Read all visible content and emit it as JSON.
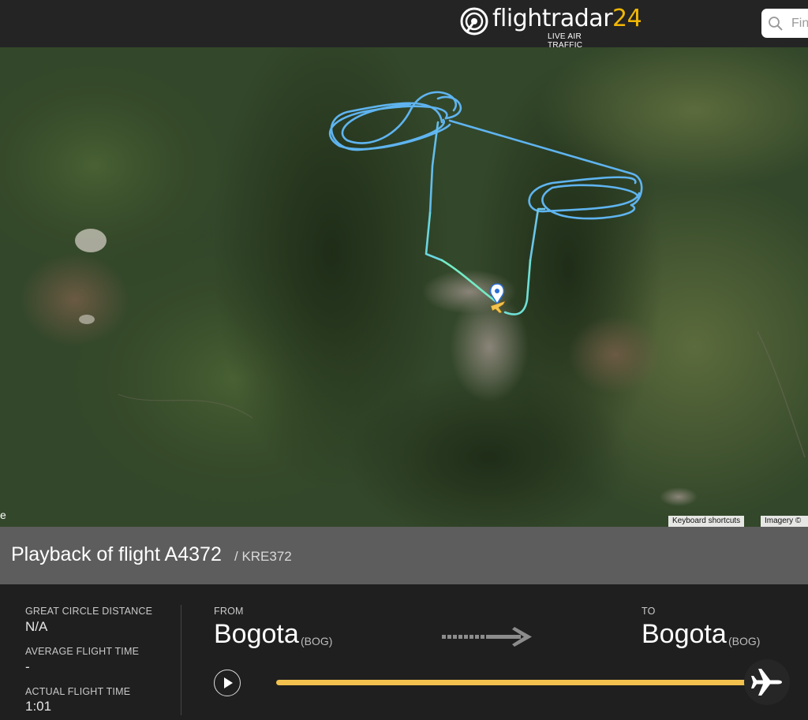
{
  "header": {
    "logo_text": "flightradar",
    "logo_number": "24",
    "tagline": "LIVE AIR TRAFFIC",
    "search_placeholder": "Fin"
  },
  "map": {
    "keyboard_shortcuts": "Keyboard shortcuts",
    "imagery_label": "Imagery ©",
    "edge_glyph": "e"
  },
  "playback": {
    "title": "Playback of flight A4372",
    "callsign": "/ KRE372"
  },
  "stats": {
    "great_circle_label": "GREAT CIRCLE DISTANCE",
    "great_circle_value": "N/A",
    "avg_label": "AVERAGE FLIGHT TIME",
    "avg_value": "-",
    "actual_label": "ACTUAL FLIGHT TIME",
    "actual_value": "1:01"
  },
  "route": {
    "from_label": "FROM",
    "from_city": "Bogota",
    "from_code": "(BOG)",
    "to_label": "TO",
    "to_city": "Bogota",
    "to_code": "(BOG)"
  },
  "player": {
    "progress": 1.0
  },
  "colors": {
    "accent": "#f2c14e",
    "track_blue": "#5fb4f0",
    "track_cyan": "#6ee8d6"
  }
}
